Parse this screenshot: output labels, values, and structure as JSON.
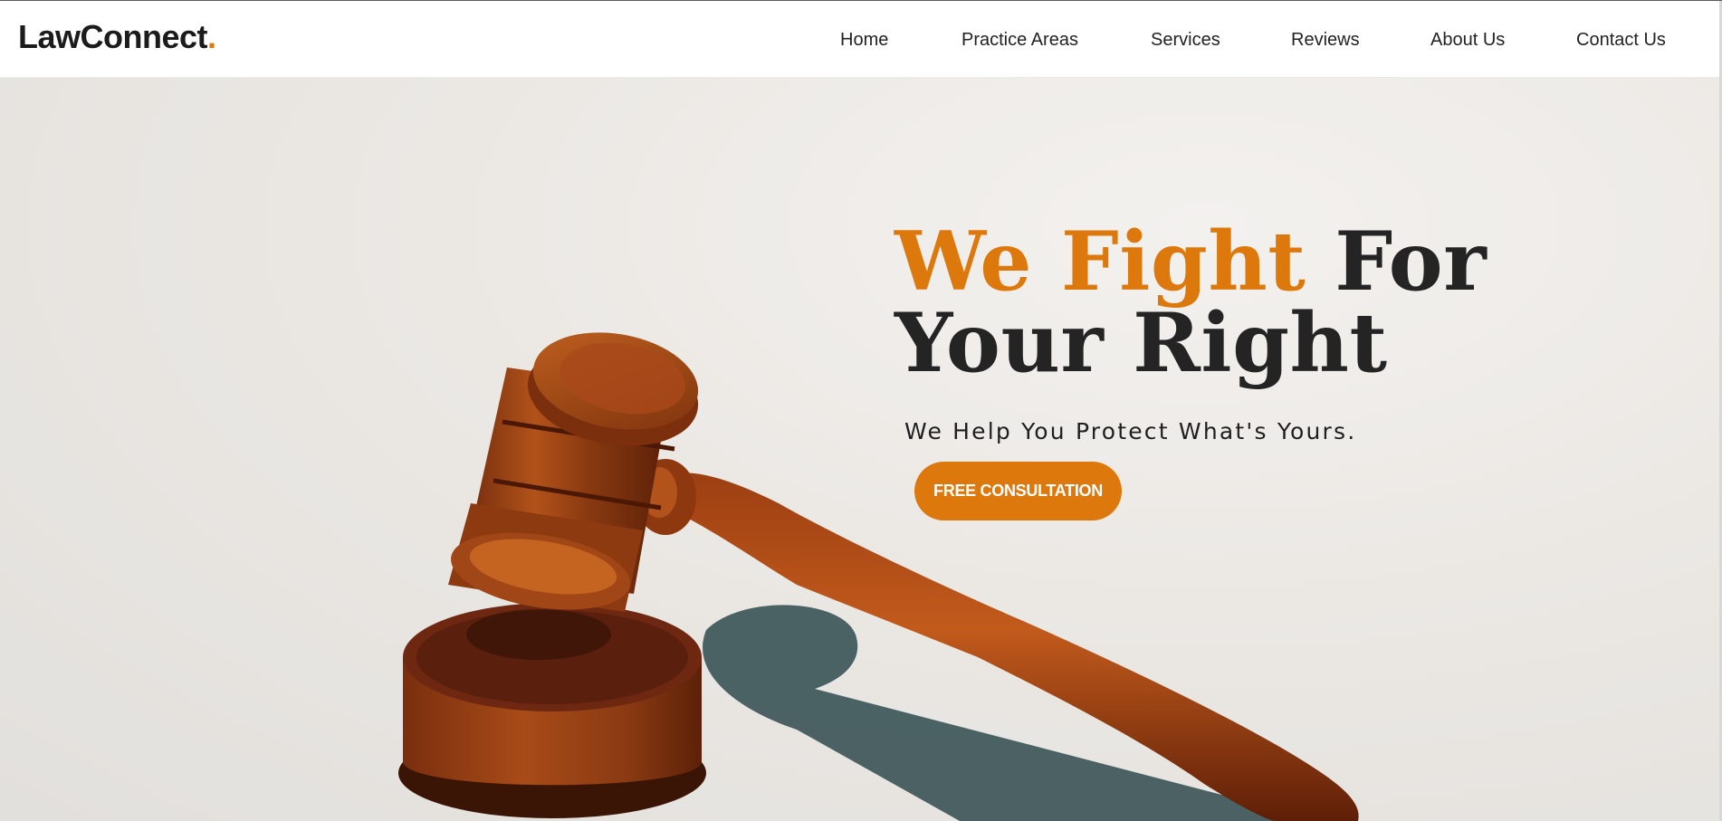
{
  "brand": {
    "name": "LawConnect",
    "dot": ".",
    "accent_color": "#dd780d"
  },
  "nav": {
    "items": [
      {
        "label": "Home"
      },
      {
        "label": "Practice Areas"
      },
      {
        "label": "Services"
      },
      {
        "label": "Reviews"
      },
      {
        "label": "About Us"
      },
      {
        "label": "Contact Us"
      }
    ]
  },
  "hero": {
    "headline_accent": "We Fight",
    "headline_rest": " For Your Right",
    "subheadline": "We Help You Protect What's Yours.",
    "cta_label": "FREE CONSULTATION",
    "image_subject": "gavel-image"
  }
}
